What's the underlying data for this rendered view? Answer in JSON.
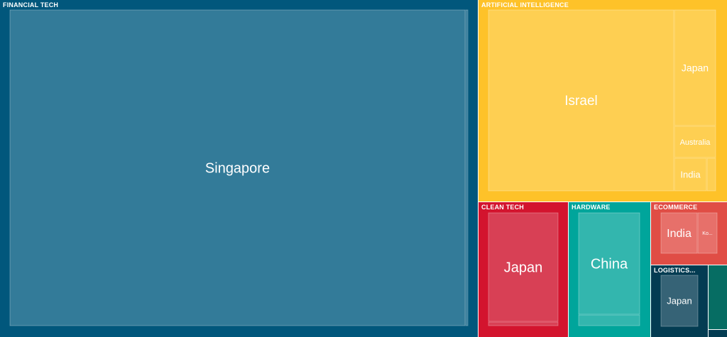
{
  "chart_data": {
    "type": "treemap",
    "groups": [
      {
        "name": "FINANCIAL TECH",
        "color": "#01577c",
        "leaf_color": "#337b99",
        "children": [
          {
            "name": "Singapore",
            "show_label": true
          },
          {
            "name": "",
            "show_label": false
          }
        ]
      },
      {
        "name": "ARTIFICIAL INTELLIGENCE",
        "color": "#fec229",
        "leaf_color": "#fecf52",
        "children": [
          {
            "name": "Israel",
            "show_label": true
          },
          {
            "name": "Japan",
            "show_label": true
          },
          {
            "name": "Australia",
            "show_label": true
          },
          {
            "name": "India",
            "show_label": true
          },
          {
            "name": "",
            "show_label": false
          }
        ]
      },
      {
        "name": "CLEAN TECH",
        "color": "#d3142e",
        "leaf_color": "#d84055",
        "children": [
          {
            "name": "Japan",
            "show_label": true
          },
          {
            "name": "",
            "show_label": false
          }
        ]
      },
      {
        "name": "HARDWARE",
        "color": "#00a59b",
        "leaf_color": "#33b6ae",
        "children": [
          {
            "name": "China",
            "show_label": true
          },
          {
            "name": "",
            "show_label": false
          }
        ]
      },
      {
        "name": "ECOMMERCE",
        "color": "#e04d45",
        "leaf_color": "#e7706a",
        "children": [
          {
            "name": "India",
            "show_label": true
          },
          {
            "name": "Ko...",
            "show_label": true
          }
        ]
      },
      {
        "name": "LOGISTICS...",
        "color": "#033c52",
        "leaf_color": "#366376",
        "children": [
          {
            "name": "Japan",
            "show_label": true
          }
        ]
      },
      {
        "name": "",
        "color": "#066d63",
        "leaf_color": "#066d63",
        "children": []
      },
      {
        "name": "",
        "color": "#033c52",
        "leaf_color": "#033c52",
        "children": []
      }
    ]
  }
}
